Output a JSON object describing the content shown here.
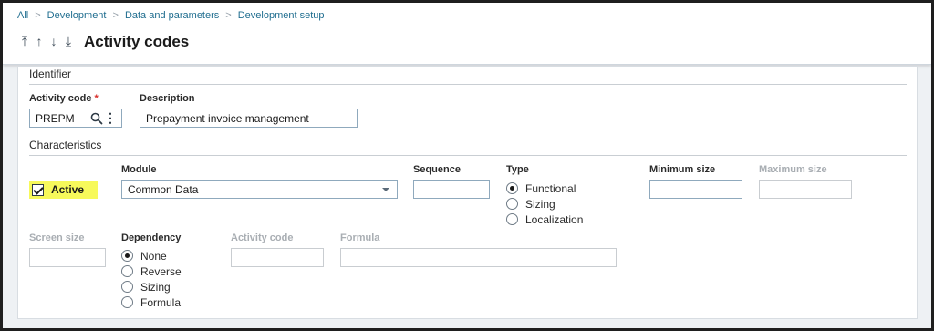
{
  "breadcrumb": {
    "items": [
      "All",
      "Development",
      "Data and parameters",
      "Development setup"
    ]
  },
  "nav": {
    "first": "⤒",
    "prev": "↑",
    "next": "↓",
    "last": "⤓"
  },
  "page_title": "Activity codes",
  "sections": {
    "identifier": "Identifier",
    "characteristics": "Characteristics"
  },
  "identifier": {
    "activity_code_label": "Activity code",
    "required_marker": "*",
    "activity_code_value": "PREPM",
    "description_label": "Description",
    "description_value": "Prepayment invoice management"
  },
  "characteristics": {
    "active_label": "Active",
    "active_checked": true,
    "module_label": "Module",
    "module_value": "Common Data",
    "sequence_label": "Sequence",
    "sequence_value": "",
    "type_label": "Type",
    "type_options": [
      "Functional",
      "Sizing",
      "Localization"
    ],
    "type_selected": "Functional",
    "minimum_size_label": "Minimum size",
    "maximum_size_label": "Maximum size",
    "screen_size_label": "Screen size",
    "dependency_label": "Dependency",
    "dependency_options": [
      "None",
      "Reverse",
      "Sizing",
      "Formula"
    ],
    "dependency_selected": "None",
    "dep_activity_code_label": "Activity code",
    "formula_label": "Formula"
  },
  "colors": {
    "link": "#1f6d8f",
    "required": "#d9302c",
    "highlight": "#f7f95b",
    "disabled_label": "#a9aeb3"
  }
}
